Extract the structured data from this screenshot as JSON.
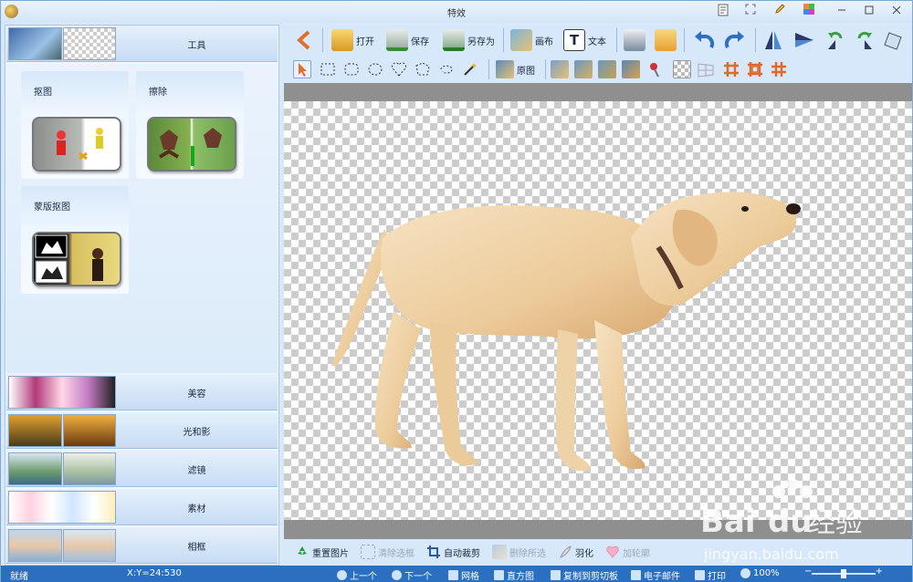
{
  "window": {
    "title": "特效"
  },
  "left_panel": {
    "categories": [
      {
        "label": "工具"
      },
      {
        "label": "美容"
      },
      {
        "label": "光和影"
      },
      {
        "label": "滤镜"
      },
      {
        "label": "素材"
      },
      {
        "label": "相框"
      }
    ],
    "tools": [
      {
        "label": "抠图"
      },
      {
        "label": "擦除"
      },
      {
        "label": "蒙版抠图"
      }
    ]
  },
  "toolbar": {
    "open": "打开",
    "save": "保存",
    "save_as": "另存为",
    "canvas": "画布",
    "text": "文本"
  },
  "toolbar2": {
    "original": "原图"
  },
  "bottom_tools": {
    "reset": "重置图片",
    "clear_selection": "清除选框",
    "auto_crop": "自动裁剪",
    "delete_selection": "删除所选",
    "feather": "羽化",
    "add_frame": "加轮廓"
  },
  "status": {
    "ready": "就绪",
    "coords": "X:Y=24:530",
    "prev": "上一个",
    "next": "下一个",
    "grid": "网格",
    "histogram": "直方图",
    "copy_clipboard": "复制到剪切板",
    "email": "电子邮件",
    "print": "打印",
    "zoom": "100%",
    "zoom_level": 0.5
  },
  "watermark": {
    "brand": "Bai",
    "brand_mid": "du",
    "jingyan": "经验",
    "url": "jingyan.baidu.com"
  },
  "colors": {
    "accent": "#2a6fc0",
    "panel": "#d6e8fa"
  }
}
